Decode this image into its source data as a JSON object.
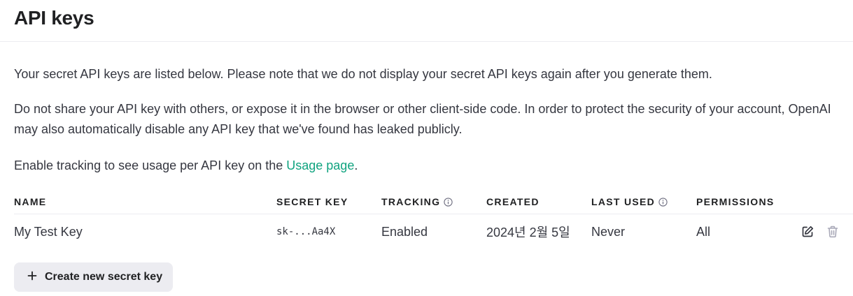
{
  "header": {
    "title": "API keys"
  },
  "intro": {
    "paragraph_1": "Your secret API keys are listed below. Please note that we do not display your secret API keys again after you generate them.",
    "paragraph_2": "Do not share your API key with others, or expose it in the browser or other client-side code. In order to protect the security of your account, OpenAI may also automatically disable any API key that we've found has leaked publicly.",
    "paragraph_3_prefix": "Enable tracking to see usage per API key on the ",
    "paragraph_3_link": "Usage page",
    "paragraph_3_suffix": "."
  },
  "table": {
    "columns": {
      "name": "NAME",
      "secret_key": "SECRET KEY",
      "tracking": "TRACKING",
      "created": "CREATED",
      "last_used": "LAST USED",
      "permissions": "PERMISSIONS"
    },
    "rows": [
      {
        "name": "My Test Key",
        "secret_key": "sk-...Aa4X",
        "tracking": "Enabled",
        "created": "2024년 2월 5일",
        "last_used": "Never",
        "permissions": "All",
        "actions": [
          "edit-icon",
          "trash-icon"
        ]
      }
    ]
  },
  "create_button": {
    "icon": "plus-icon",
    "label": "Create new secret key"
  },
  "colors": {
    "link": "#10a37f",
    "button_bg": "#ececf1",
    "text": "#353740",
    "heading": "#202123"
  }
}
